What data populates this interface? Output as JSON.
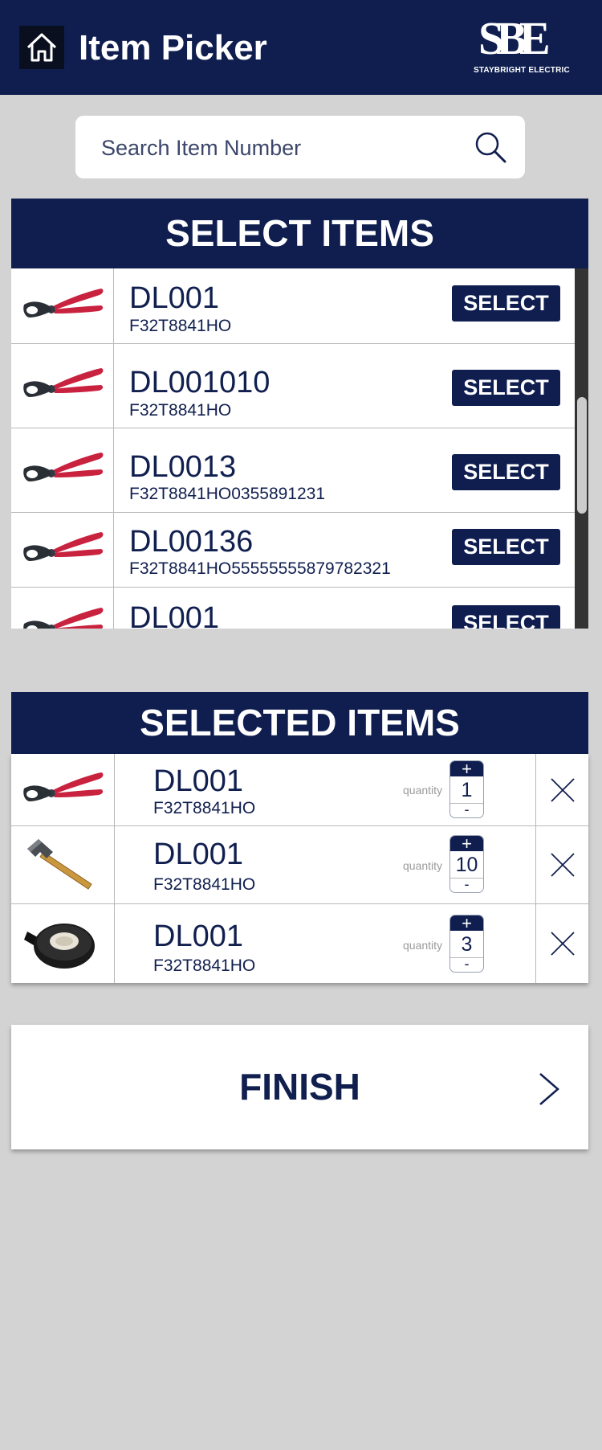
{
  "header": {
    "title": "Item Picker",
    "logo_letters": "SBE",
    "logo_text": "STAYBRIGHT ELECTRIC",
    "background": "#0f1e4f"
  },
  "search": {
    "placeholder": "Search Item Number"
  },
  "select_section": {
    "title": "SELECT ITEMS",
    "button_label": "SELECT",
    "items": [
      {
        "code": "DL001",
        "sub": "F32T8841HO",
        "icon": "wire-cutter-icon"
      },
      {
        "code": "DL001010",
        "sub": "F32T8841HO",
        "icon": "wire-cutter-icon"
      },
      {
        "code": "DL0013",
        "sub": "F32T8841HO0355891231",
        "icon": "wire-cutter-icon"
      },
      {
        "code": "DL00136",
        "sub": "F32T8841HO55555555879782321",
        "icon": "wire-cutter-icon"
      },
      {
        "code": "DL001",
        "sub": "",
        "icon": "wire-cutter-icon"
      }
    ]
  },
  "selected_section": {
    "title": "SELECTED ITEMS",
    "quantity_label": "quantity",
    "plus": "+",
    "minus": "-",
    "items": [
      {
        "code": "DL001",
        "sub": "F32T8841HO",
        "quantity": "1",
        "icon": "wire-cutter-icon"
      },
      {
        "code": "DL001",
        "sub": "F32T8841HO",
        "quantity": "10",
        "icon": "hammer-icon"
      },
      {
        "code": "DL001",
        "sub": "F32T8841HO",
        "quantity": "3",
        "icon": "electrical-tape-icon"
      }
    ]
  },
  "finish": {
    "label": "FINISH"
  },
  "colors": {
    "navy": "#0f1e4f",
    "text": "#111f4f",
    "background": "#d3d3d3",
    "tool_red": "#c9223f"
  }
}
